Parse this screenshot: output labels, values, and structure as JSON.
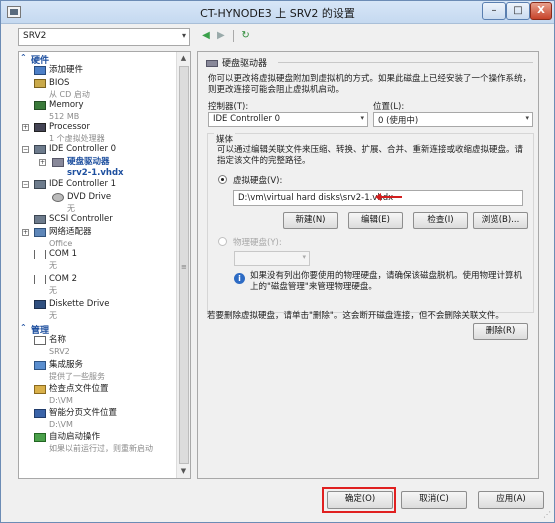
{
  "window": {
    "title": "CT-HYNODE3 上 SRV2 的设置",
    "minimize": "–",
    "maximize": "□",
    "close": "X"
  },
  "vm_select": {
    "value": "SRV2"
  },
  "tree": {
    "hardware_header": "硬件",
    "management_header": "管理",
    "items": [
      {
        "label": "添加硬件",
        "sub": ""
      },
      {
        "label": "BIOS",
        "sub": "从 CD 启动"
      },
      {
        "label": "Memory",
        "sub": "512 MB"
      },
      {
        "label": "Processor",
        "sub": "1 个虚拟处理器"
      },
      {
        "label": "IDE Controller 0",
        "sub": ""
      },
      {
        "label": "硬盘驱动器",
        "sub": "srv2-1.vhdx"
      },
      {
        "label": "IDE Controller 1",
        "sub": ""
      },
      {
        "label": "DVD Drive",
        "sub": "无"
      },
      {
        "label": "SCSI Controller",
        "sub": ""
      },
      {
        "label": "网络适配器",
        "sub": "Office"
      },
      {
        "label": "COM 1",
        "sub": "无"
      },
      {
        "label": "COM 2",
        "sub": "无"
      },
      {
        "label": "Diskette Drive",
        "sub": "无"
      }
    ],
    "mgmt_items": [
      {
        "label": "名称",
        "sub": "SRV2"
      },
      {
        "label": "集成服务",
        "sub": "提供了一些服务"
      },
      {
        "label": "检查点文件位置",
        "sub": "D:\\VM"
      },
      {
        "label": "智能分页文件位置",
        "sub": "D:\\VM"
      },
      {
        "label": "自动启动操作",
        "sub": "如果以前运行过，则重新启动"
      }
    ]
  },
  "panel": {
    "heading": "硬盘驱动器",
    "intro": "你可以更改将虚拟硬盘附加到虚拟机的方式。如果此磁盘上已经安装了一个操作系统，则更改连接可能会阻止虚拟机启动。",
    "controller_label": "控制器(T):",
    "controller_value": "IDE Controller 0",
    "location_label": "位置(L):",
    "location_value": "0 (使用中)",
    "media_title": "媒体",
    "media_desc": "可以通过编辑关联文件来压缩、转换、扩展、合并、重新连接或收缩虚拟硬盘。请指定该文件的完整路径。",
    "vhd_label": "虚拟硬盘(V):",
    "vhd_path": "D:\\vm\\virtual hard disks\\srv2-1.vhdx",
    "btn_new": "新建(N)",
    "btn_edit": "编辑(E)",
    "btn_inspect": "检查(I)",
    "btn_browse": "浏览(B)...",
    "phys_label": "物理硬盘(Y):",
    "info_text": "如果没有列出你要使用的物理硬盘，请确保该磁盘脱机。使用物理计算机上的\"磁盘管理\"来管理物理硬盘。",
    "remove_text": "若要删除虚拟硬盘，请单击\"删除\"。这会断开磁盘连接，但不会删除关联文件。",
    "btn_remove": "删除(R)"
  },
  "footer": {
    "ok": "确定(O)",
    "cancel": "取消(C)",
    "apply": "应用(A)"
  },
  "colors": {
    "accent": "#1c4e9e",
    "highlight_red": "#e02020"
  }
}
